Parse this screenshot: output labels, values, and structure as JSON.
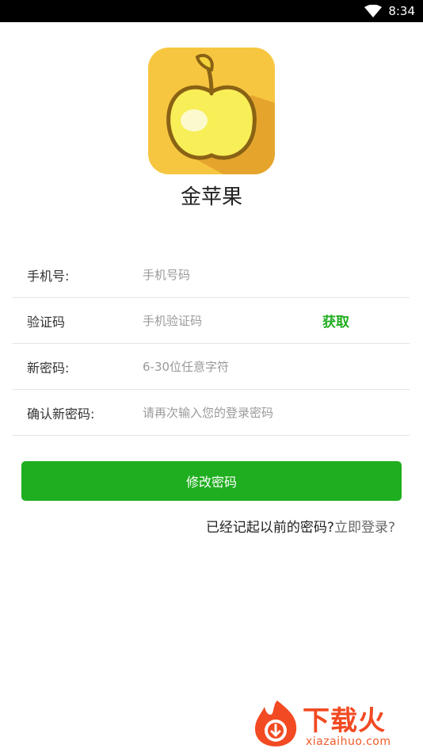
{
  "status_bar": {
    "time": "8:34",
    "wifi_icon": "wifi-icon"
  },
  "app": {
    "name": "金苹果",
    "logo_icon": "golden-apple-icon"
  },
  "form": {
    "phone": {
      "label": "手机号:",
      "placeholder": "手机号码"
    },
    "code": {
      "label": "验证码",
      "placeholder": "手机验证码",
      "get_label": "获取"
    },
    "new_password": {
      "label": "新密码:",
      "placeholder": "6-30位任意字符"
    },
    "confirm_password": {
      "label": "确认新密码:",
      "placeholder": "请再次输入您的登录密码"
    }
  },
  "submit_label": "修改密码",
  "login_prompt": {
    "text": "已经记起以前的密码?",
    "link": "立即登录?"
  },
  "watermark": {
    "brand": "下载火",
    "url": "xiazaihuo.com",
    "icon": "download-flame-icon"
  },
  "colors": {
    "accent": "#1fae1f",
    "watermark": "#f24a22"
  }
}
